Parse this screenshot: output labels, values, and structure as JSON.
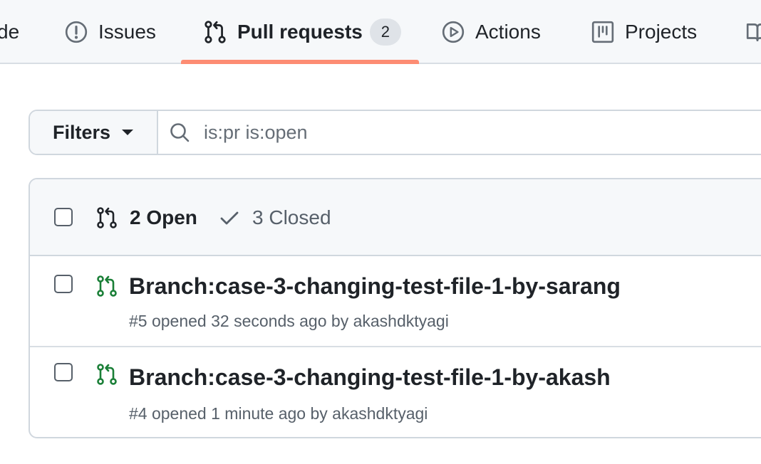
{
  "nav": {
    "tabs": [
      {
        "label": "de",
        "icon": "code-icon"
      },
      {
        "label": "Issues",
        "icon": "issue-opened-icon"
      },
      {
        "label": "Pull requests",
        "icon": "git-pull-request-icon",
        "counter": "2",
        "selected": true
      },
      {
        "label": "Actions",
        "icon": "play-icon"
      },
      {
        "label": "Projects",
        "icon": "table-icon"
      }
    ]
  },
  "filters": {
    "button_label": "Filters",
    "search_value": "is:pr is:open"
  },
  "list": {
    "open_label": "2 Open",
    "closed_label": "3 Closed",
    "items": [
      {
        "title": "Branch:case-3-changing-test-file-1-by-sarang",
        "meta": "#5 opened 32 seconds ago by akashdktyagi"
      },
      {
        "title": "Branch:case-3-changing-test-file-1-by-akash",
        "meta": "#4 opened 1 minute ago by akashdktyagi"
      }
    ]
  },
  "colors": {
    "accent_underline": "#fd8c73",
    "open_pr_green": "#1a7f37",
    "header_bg": "#f6f8fa",
    "border": "#d0d7de"
  }
}
